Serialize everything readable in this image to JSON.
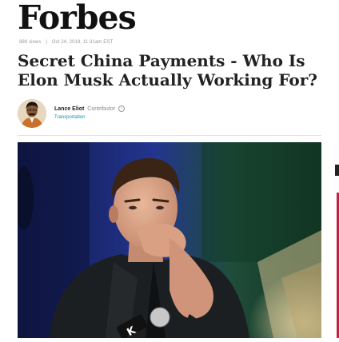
{
  "brand": {
    "logo_text": "Forbes"
  },
  "article": {
    "views": "888 views",
    "separator": "|",
    "date": "Oct 24, 2019, 11:31am EST",
    "headline": "Secret China Payments - Who Is Elon Musk Actually Working For?",
    "author": {
      "name": "Lance Eliot",
      "role": "Contributor",
      "info_icon": "i",
      "channel": "Transportation"
    }
  },
  "hero_image": {
    "icon": "photo-of-man-hand-on-chin",
    "microphone_brand": "K"
  },
  "colors": {
    "channel_link": "#1a8cb0",
    "headline": "#222222",
    "meta": "#999999"
  }
}
